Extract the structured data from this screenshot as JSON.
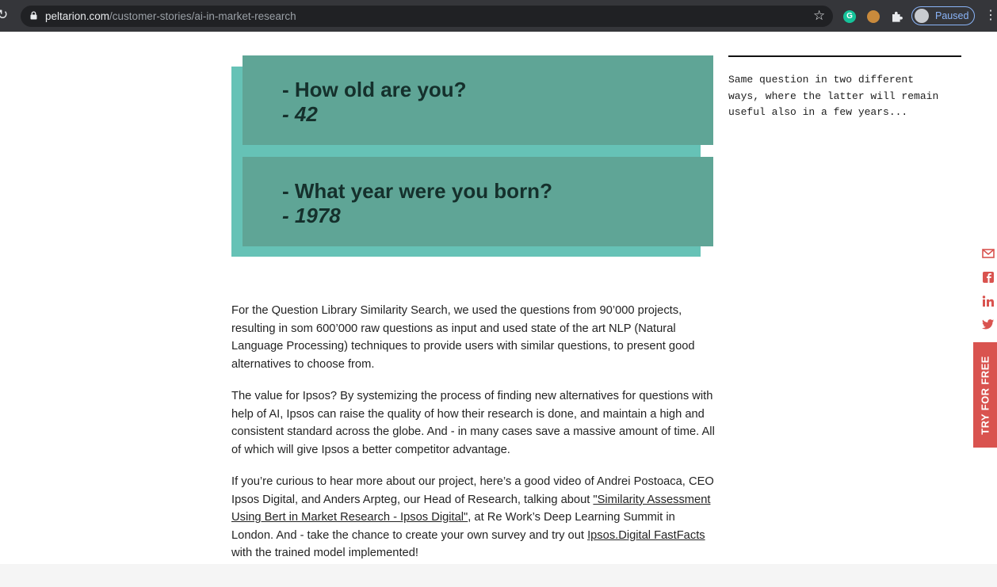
{
  "browser": {
    "url_domain": "peltarion.com",
    "url_path": "/customer-stories/ai-in-market-research",
    "profile_label": "Paused",
    "icons": [
      "reload-icon",
      "lock-icon",
      "bookmark-star-icon",
      "grammarly-extension-icon",
      "cookie-extension-icon",
      "extensions-puzzle-icon",
      "profile-avatar-icon",
      "more-menu-icon"
    ]
  },
  "illustration": {
    "card1": {
      "question": "- How old are you?",
      "answer": "- 42"
    },
    "card2": {
      "question": "- What year were you born?",
      "answer": "- 1978"
    }
  },
  "side_note": "Same question in two different\nways, where the latter will remain\nuseful also in a few years...",
  "article": {
    "p1": "For the Question Library Similarity Search, we used the questions from 90’000 projects, resulting in som 600’000 raw questions as input and used state of the art NLP (Natural Language Processing) techniques to provide users with similar questions, to present good alternatives to choose from.",
    "p2": "The value for Ipsos? By systemizing the process of finding new alternatives for questions with help of AI, Ipsos can raise the quality of how their research is done, and maintain a high and consistent standard across the globe. And - in many cases save a massive amount of time. All of which will give Ipsos a better competitor advantage.",
    "p3_part1": "If you’re curious to hear more about our project, here’s a good video of Andrei Postoaca, CEO Ipsos Digital, and Anders Arpteg, our Head of Research, talking about ",
    "p3_link1": "\"Similarity Assessment Using Bert in Market Research - Ipsos Digital\"",
    "p3_part2": ", at Re Work’s Deep Learning Summit in London. And - take the chance to create your own survey and try out ",
    "p3_link2": "Ipsos.Digital FastFacts",
    "p3_part3": " with the trained model implemented!"
  },
  "share_icons": [
    "email-icon",
    "facebook-icon",
    "linkedin-icon",
    "twitter-icon"
  ],
  "cta": {
    "label": "TRY FOR FREE"
  },
  "colors": {
    "card_dark": "#5fa596",
    "card_light": "#66c2b6",
    "cta": "#d9534f",
    "chrome_bar": "#35363a"
  }
}
